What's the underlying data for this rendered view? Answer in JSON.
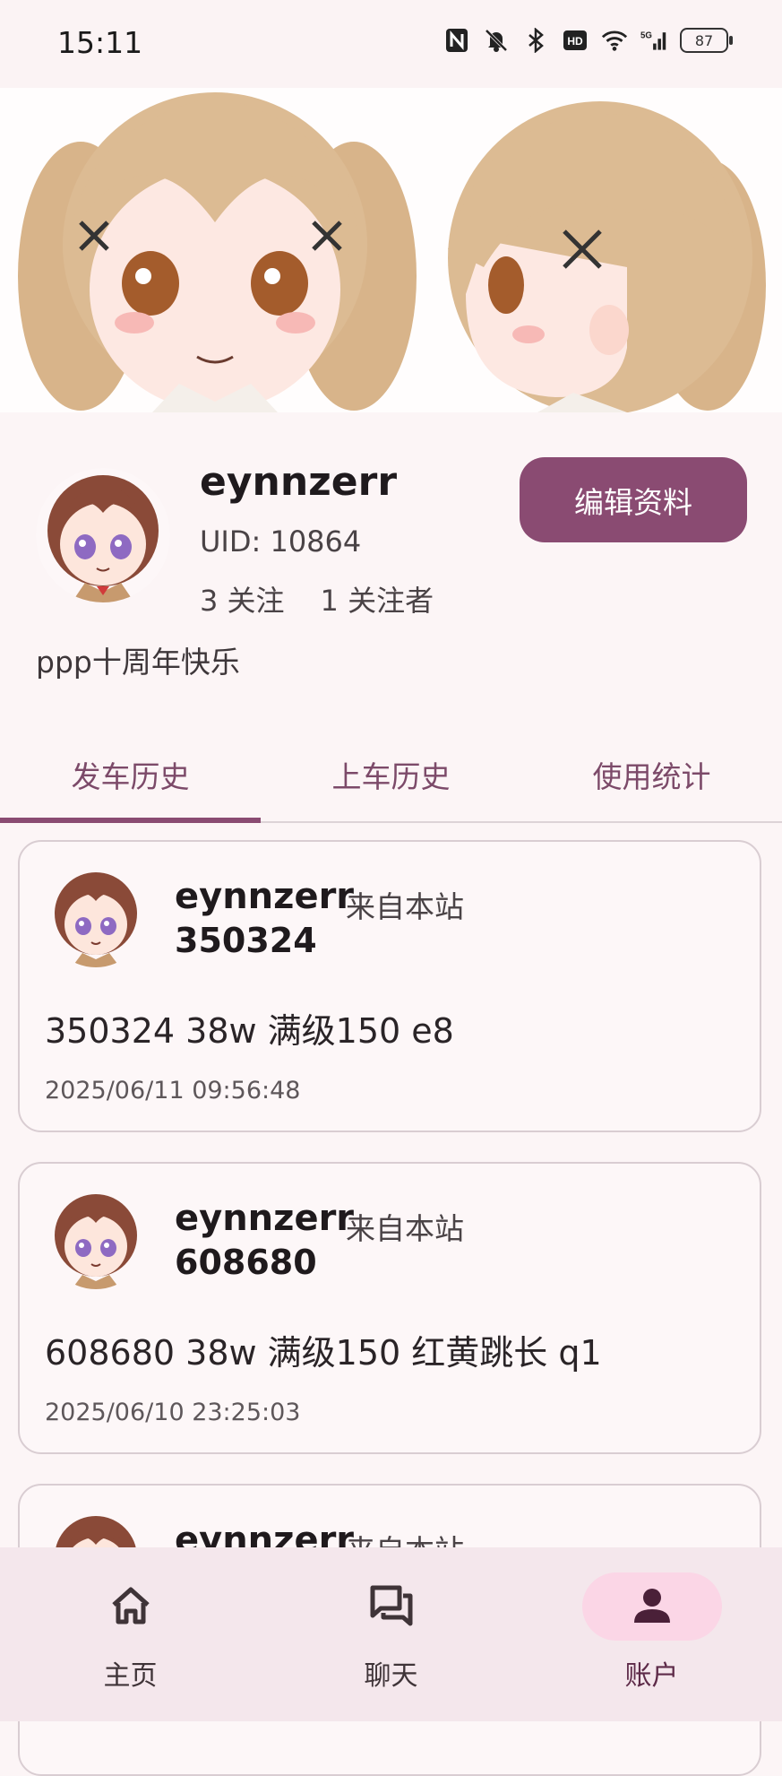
{
  "status_bar": {
    "time": "15:11",
    "battery": "87",
    "icons": [
      "nfc-icon",
      "mute-icon",
      "bluetooth-icon",
      "hd-icon",
      "wifi-icon",
      "5g-signal-icon",
      "battery-icon"
    ]
  },
  "profile": {
    "username": "eynnzerr",
    "uid": "UID: 10864",
    "following": "3 关注",
    "followers": "1 关注者",
    "edit_label": "编辑资料",
    "bio": "ppp十周年快乐"
  },
  "tabs": [
    {
      "label": "发车历史",
      "active": true
    },
    {
      "label": "上车历史",
      "active": false
    },
    {
      "label": "使用统计",
      "active": false
    }
  ],
  "posts": [
    {
      "username": "eynnzerr",
      "source": "来自本站",
      "room": "350324",
      "message": "350324 38w 满级150 e8",
      "time": "2025/06/11 09:56:48"
    },
    {
      "username": "eynnzerr",
      "source": "来自本站",
      "room": "608680",
      "message": "608680 38w 满级150 红黄跳长 q1",
      "time": "2025/06/10 23:25:03"
    },
    {
      "username": "eynnzerr",
      "source": "来自本站",
      "room": "",
      "message": "",
      "time": ""
    }
  ],
  "bottom_nav": [
    {
      "label": "主页",
      "icon": "home-icon",
      "active": false
    },
    {
      "label": "聊天",
      "icon": "chat-icon",
      "active": false
    },
    {
      "label": "账户",
      "icon": "account-icon",
      "active": true
    }
  ],
  "colors": {
    "accent": "#8a4b72",
    "background": "#fcf5f6",
    "nav_background": "#f4e7ec",
    "nav_active_pill": "#fbd6e6"
  }
}
